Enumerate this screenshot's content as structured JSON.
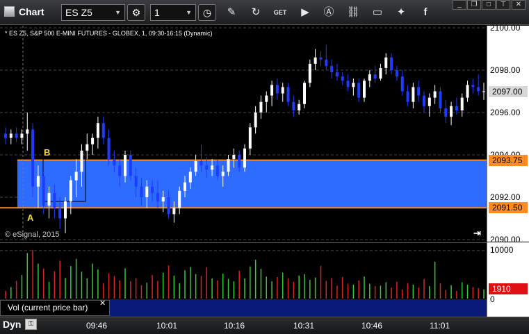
{
  "toolbar": {
    "title": "Chart",
    "symbol_value": "ES Z5",
    "interval_value": "1"
  },
  "chart": {
    "legend": "* ES Z5, S&P 500 E-MINI FUTURES - GLOBEX, 1, 09:30-16:15 (Dynamic)",
    "copyright": "© eSignal, 2015",
    "label_a": "A",
    "label_b": "B",
    "price_ticks": [
      "2100.00",
      "2098.00",
      "2096.00",
      "2094.00",
      "2092.00",
      "2090.00"
    ],
    "current_price": "2097.00",
    "upper_level": "2093.75",
    "lower_level": "2091.50",
    "colors": {
      "band": "#2e6cff",
      "level_line": "#ff8a1f",
      "up": "#ffffff",
      "down": "#1e3cff"
    }
  },
  "volume": {
    "label": "Vol (current price bar)",
    "ticks": [
      "10000",
      "0"
    ],
    "current_value": "1910",
    "colors": {
      "up": "#33cc33",
      "down": "#dd2222",
      "current": "#dd1111"
    }
  },
  "time_axis": {
    "dyn_label": "Dyn",
    "ticks": [
      "09:46",
      "10:01",
      "10:16",
      "10:31",
      "10:46",
      "11:01"
    ]
  },
  "icons": [
    "gear-icon",
    "clock-icon",
    "pencil-icon",
    "refresh-icon",
    "get-icon",
    "play-icon",
    "a-icon",
    "link-icon",
    "chat-icon",
    "twitter-icon",
    "facebook-icon"
  ],
  "chart_data": {
    "type": "candlestick",
    "x_unit": "minute bars",
    "y_range": [
      2090.0,
      2100.0
    ],
    "levels": [
      {
        "label": "2093.75",
        "value": 2093.75
      },
      {
        "label": "2091.50",
        "value": 2091.5
      }
    ],
    "candles": [
      [
        2095.0,
        2095.3,
        2094.5,
        2094.8
      ],
      [
        2094.8,
        2095.2,
        2094.5,
        2095.0
      ],
      [
        2095.0,
        2095.3,
        2094.6,
        2094.8
      ],
      [
        2094.8,
        2095.2,
        2094.5,
        2095.0
      ],
      [
        2095.0,
        2096.0,
        2094.2,
        2095.2
      ],
      [
        2095.2,
        2095.5,
        2092.0,
        2092.5
      ],
      [
        2092.5,
        2093.5,
        2091.5,
        2093.0
      ],
      [
        2093.0,
        2093.3,
        2091.2,
        2091.6
      ],
      [
        2091.6,
        2092.5,
        2091.0,
        2092.2
      ],
      [
        2092.2,
        2092.6,
        2091.0,
        2091.5
      ],
      [
        2091.5,
        2092.0,
        2090.5,
        2091.0
      ],
      [
        2091.0,
        2092.0,
        2090.3,
        2091.8
      ],
      [
        2091.8,
        2093.0,
        2091.2,
        2092.8
      ],
      [
        2092.8,
        2093.8,
        2092.0,
        2093.2
      ],
      [
        2093.2,
        2094.5,
        2092.5,
        2094.2
      ],
      [
        2094.2,
        2095.0,
        2093.8,
        2094.5
      ],
      [
        2094.5,
        2095.0,
        2094.0,
        2094.8
      ],
      [
        2094.8,
        2095.8,
        2094.3,
        2095.5
      ],
      [
        2095.5,
        2095.8,
        2094.5,
        2094.8
      ],
      [
        2094.8,
        2095.2,
        2093.5,
        2093.8
      ],
      [
        2093.8,
        2094.2,
        2093.2,
        2093.5
      ],
      [
        2093.5,
        2093.8,
        2092.5,
        2093.0
      ],
      [
        2093.0,
        2094.2,
        2092.7,
        2094.0
      ],
      [
        2094.0,
        2094.2,
        2092.8,
        2093.0
      ],
      [
        2093.0,
        2093.4,
        2092.0,
        2092.5
      ],
      [
        2092.5,
        2092.9,
        2091.6,
        2092.0
      ],
      [
        2092.0,
        2092.8,
        2091.5,
        2092.5
      ],
      [
        2092.5,
        2092.8,
        2091.8,
        2092.2
      ],
      [
        2092.2,
        2092.8,
        2091.5,
        2091.8
      ],
      [
        2091.8,
        2092.3,
        2091.3,
        2092.0
      ],
      [
        2092.0,
        2092.3,
        2091.0,
        2091.2
      ],
      [
        2091.2,
        2091.8,
        2090.8,
        2091.5
      ],
      [
        2091.5,
        2092.5,
        2091.2,
        2092.3
      ],
      [
        2092.3,
        2093.0,
        2092.0,
        2092.7
      ],
      [
        2092.7,
        2093.4,
        2092.4,
        2093.2
      ],
      [
        2093.2,
        2094.0,
        2093.0,
        2093.7
      ],
      [
        2093.7,
        2094.5,
        2093.2,
        2093.5
      ],
      [
        2093.5,
        2093.9,
        2092.9,
        2093.3
      ],
      [
        2093.3,
        2093.8,
        2093.0,
        2093.5
      ],
      [
        2093.5,
        2093.8,
        2092.8,
        2093.0
      ],
      [
        2093.0,
        2093.5,
        2092.5,
        2093.2
      ],
      [
        2093.2,
        2094.0,
        2093.0,
        2093.8
      ],
      [
        2093.8,
        2094.3,
        2093.4,
        2094.0
      ],
      [
        2094.0,
        2094.2,
        2093.2,
        2093.4
      ],
      [
        2093.4,
        2094.5,
        2093.2,
        2094.3
      ],
      [
        2094.3,
        2095.5,
        2094.0,
        2095.3
      ],
      [
        2095.3,
        2096.3,
        2095.0,
        2096.0
      ],
      [
        2096.0,
        2096.8,
        2095.7,
        2096.5
      ],
      [
        2096.5,
        2097.0,
        2096.0,
        2096.8
      ],
      [
        2096.8,
        2097.5,
        2096.3,
        2097.3
      ],
      [
        2097.3,
        2097.6,
        2096.6,
        2096.9
      ],
      [
        2096.9,
        2097.4,
        2096.5,
        2097.2
      ],
      [
        2097.2,
        2097.4,
        2096.3,
        2096.5
      ],
      [
        2096.5,
        2096.8,
        2095.8,
        2096.1
      ],
      [
        2096.1,
        2096.6,
        2095.9,
        2096.4
      ],
      [
        2096.4,
        2097.5,
        2096.2,
        2097.4
      ],
      [
        2097.4,
        2098.5,
        2097.2,
        2098.3
      ],
      [
        2098.3,
        2099.0,
        2098.0,
        2098.6
      ],
      [
        2098.6,
        2098.9,
        2098.2,
        2098.5
      ],
      [
        2098.5,
        2099.2,
        2098.0,
        2098.2
      ],
      [
        2098.2,
        2098.5,
        2097.6,
        2097.9
      ],
      [
        2097.9,
        2098.3,
        2097.5,
        2097.7
      ],
      [
        2097.7,
        2097.9,
        2097.3,
        2097.5
      ],
      [
        2097.5,
        2097.8,
        2097.0,
        2097.2
      ],
      [
        2097.2,
        2097.6,
        2096.8,
        2097.4
      ],
      [
        2097.4,
        2097.6,
        2096.5,
        2096.7
      ],
      [
        2096.7,
        2097.6,
        2096.5,
        2097.5
      ],
      [
        2097.5,
        2098.0,
        2097.2,
        2097.8
      ],
      [
        2097.8,
        2098.2,
        2097.4,
        2097.6
      ],
      [
        2097.6,
        2098.3,
        2097.5,
        2098.1
      ],
      [
        2098.1,
        2098.8,
        2097.8,
        2098.6
      ],
      [
        2098.6,
        2098.8,
        2097.8,
        2098.0
      ],
      [
        2098.0,
        2098.2,
        2097.5,
        2097.7
      ],
      [
        2097.7,
        2098.0,
        2096.8,
        2097.0
      ],
      [
        2097.0,
        2097.3,
        2096.3,
        2096.5
      ],
      [
        2096.5,
        2097.4,
        2096.2,
        2097.2
      ],
      [
        2097.2,
        2097.5,
        2096.5,
        2096.8
      ],
      [
        2096.8,
        2097.0,
        2096.0,
        2096.3
      ],
      [
        2096.3,
        2096.9,
        2095.8,
        2096.7
      ],
      [
        2096.7,
        2097.3,
        2096.4,
        2097.0
      ],
      [
        2097.0,
        2097.2,
        2096.0,
        2096.2
      ],
      [
        2096.2,
        2096.6,
        2095.5,
        2095.8
      ],
      [
        2095.8,
        2096.5,
        2095.4,
        2096.3
      ],
      [
        2096.3,
        2096.7,
        2095.9,
        2096.1
      ],
      [
        2096.1,
        2096.9,
        2095.8,
        2096.7
      ],
      [
        2096.7,
        2097.5,
        2096.5,
        2097.3
      ],
      [
        2097.3,
        2097.6,
        2096.9,
        2097.2
      ],
      [
        2097.2,
        2097.8,
        2096.8,
        2097.0
      ],
      [
        2097.0,
        2097.4,
        2096.6,
        2097.0
      ]
    ],
    "volume": [
      1600,
      2400,
      3700,
      4900,
      9500,
      10100,
      7300,
      6300,
      3500,
      5700,
      7900,
      4300,
      6800,
      8300,
      5600,
      4200,
      7300,
      6100,
      3200,
      5300,
      4700,
      3800,
      6300,
      3600,
      4300,
      2800,
      3300,
      4900,
      3700,
      5400,
      6900,
      4800,
      3200,
      5900,
      6600,
      5100,
      4700,
      6500,
      4200,
      3800,
      5200,
      4100,
      3600,
      5800,
      4200,
      6700,
      8100,
      6200,
      4600,
      3600,
      4500,
      5400,
      4200,
      3500,
      4800,
      5100,
      3900,
      4400,
      6800,
      3700,
      4300,
      2700,
      4500,
      3100,
      2900,
      3800,
      4600,
      3100,
      2600,
      2700,
      3400,
      2300,
      3500,
      1900,
      3200,
      2900,
      2300,
      4100,
      2600,
      7700,
      3200,
      1800,
      2800,
      1600,
      3400,
      2900,
      2400,
      2200,
      1910
    ]
  }
}
